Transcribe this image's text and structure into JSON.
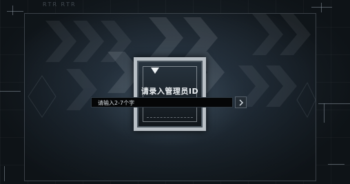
{
  "topbar": {
    "title": "ꓣꓔꓣ ꓣꓔꓣ"
  },
  "dialog": {
    "title": "请录入管理员ID",
    "input": {
      "placeholder": "请输入2-7个字",
      "value": ""
    },
    "submit_icon": "chevron-right-icon"
  },
  "colors": {
    "frame": "#b9c0c6",
    "panel_top": "#2a3745",
    "background": "#14191e",
    "input_bg": "#050607",
    "text": "#eef2f5"
  }
}
